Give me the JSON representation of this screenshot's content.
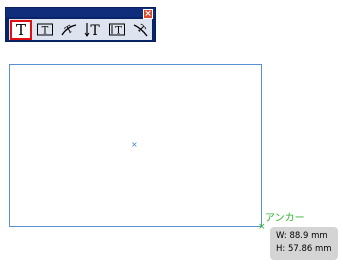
{
  "toolbar": {
    "close_label": "×",
    "tools": [
      {
        "name": "horizontal-type-tool",
        "icon": "type-tool-icon",
        "selected": true
      },
      {
        "name": "horizontal-frame-grid-tool",
        "icon": "frame-grid-icon",
        "selected": false
      },
      {
        "name": "type-on-path-tool",
        "icon": "type-on-path-icon",
        "selected": false
      },
      {
        "name": "vertical-type-tool",
        "icon": "vertical-type-icon",
        "selected": false
      },
      {
        "name": "vertical-frame-grid-tool",
        "icon": "vertical-frame-grid-icon",
        "selected": false
      },
      {
        "name": "vertical-type-on-path-tool",
        "icon": "vertical-type-on-path-icon",
        "selected": false
      }
    ]
  },
  "canvas": {
    "center_marker": "×",
    "anchor_label": "アンカー",
    "size_tooltip": {
      "width": "W: 88.9 mm",
      "height": "H: 57.86 mm"
    }
  },
  "colors": {
    "selection": "#e01010",
    "frame_border": "#5a8fd6",
    "anchor": "#2db52d"
  }
}
